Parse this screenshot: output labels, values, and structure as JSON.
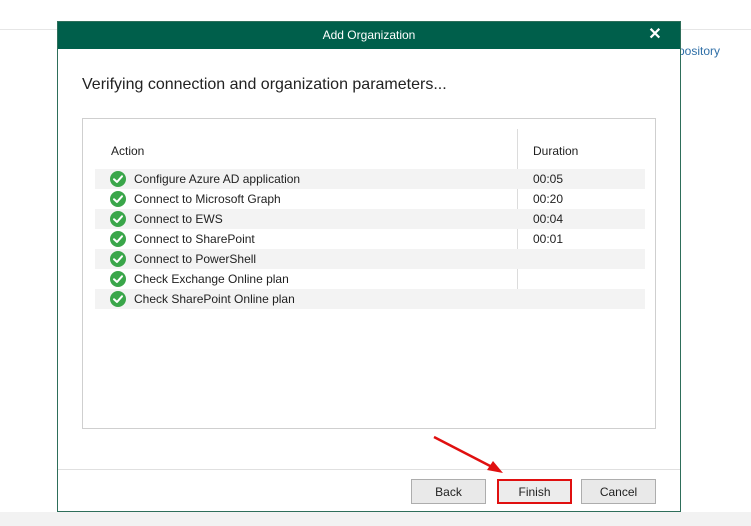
{
  "background": {
    "link_text": "pository"
  },
  "dialog": {
    "title": "Add Organization",
    "heading": "Verifying connection and organization parameters...",
    "columns": {
      "action": "Action",
      "duration": "Duration"
    },
    "rows": [
      {
        "label": "Configure Azure AD application",
        "duration": "00:05",
        "status_icon": "check-circle-icon"
      },
      {
        "label": "Connect to Microsoft Graph",
        "duration": "00:20",
        "status_icon": "check-circle-icon"
      },
      {
        "label": "Connect to EWS",
        "duration": "00:04",
        "status_icon": "check-circle-icon"
      },
      {
        "label": "Connect to SharePoint",
        "duration": "00:01",
        "status_icon": "check-circle-icon"
      },
      {
        "label": "Connect to PowerShell",
        "duration": "",
        "status_icon": "check-circle-icon"
      },
      {
        "label": "Check Exchange Online plan",
        "duration": "",
        "status_icon": "check-circle-icon"
      },
      {
        "label": "Check SharePoint Online plan",
        "duration": "",
        "status_icon": "check-circle-icon"
      }
    ],
    "buttons": {
      "back": "Back",
      "finish": "Finish",
      "cancel": "Cancel"
    }
  },
  "colors": {
    "titlebar": "#005f4b",
    "success": "#3aa64a",
    "highlight": "#e01010"
  }
}
